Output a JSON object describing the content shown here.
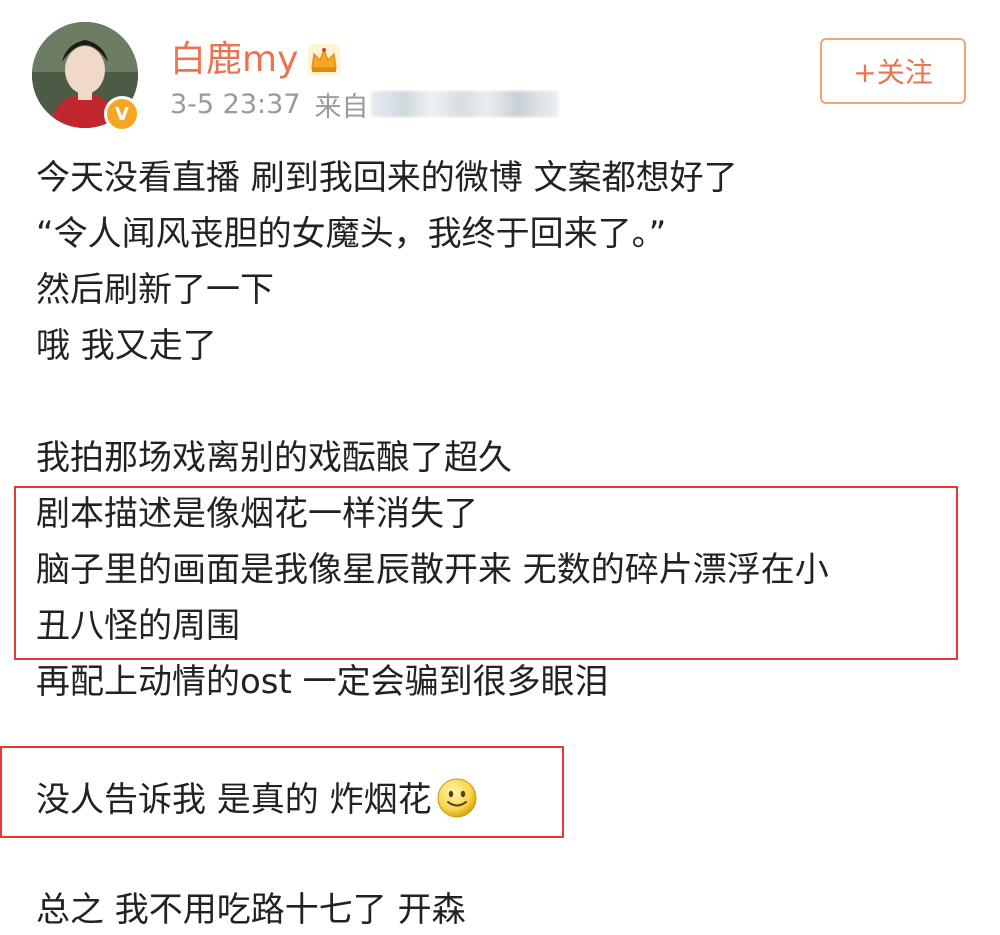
{
  "post": {
    "username": "白鹿my",
    "timestamp": "3-5 23:37",
    "source_prefix": "来自",
    "follow_label": "+关注",
    "verify_badge": "V",
    "icons": {
      "crown": "crown-icon",
      "verify": "verified-badge-icon",
      "smile": "smile-emoji-icon"
    },
    "colors": {
      "username": "#eb7350",
      "follow_border": "#f0a673",
      "meta": "#9a9a9a",
      "highlight_border": "#e53935",
      "badge": "#f6a623"
    },
    "lines": [
      "今天没看直播 刷到我回来的微博 文案都想好了",
      "“令人闻风丧胆的女魔头，我终于回来了。”",
      "然后刷新了一下",
      "哦 我又走了",
      "",
      "我拍那场戏离别的戏酝酿了超久",
      "剧本描述是像烟花一样消失了",
      "脑子里的画面是我像星辰散开来 无数的碎片漂浮在小",
      "丑八怪的周围",
      "再配上动情的ost 一定会骗到很多眼泪",
      "",
      "没人告诉我 是真的 炸烟花",
      "",
      "总之 我不用吃路十七了 开森"
    ]
  }
}
